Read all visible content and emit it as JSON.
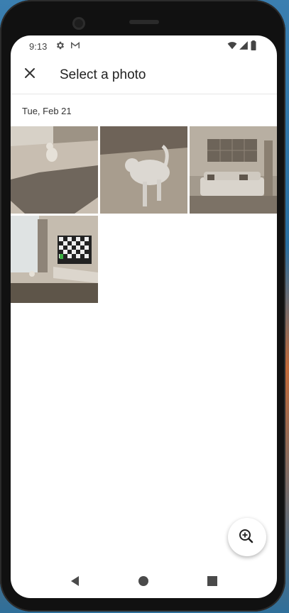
{
  "statusbar": {
    "time": "9:13",
    "icons": [
      "settings-icon",
      "gmail-icon",
      "wifi-icon",
      "signal-icon",
      "battery-icon"
    ]
  },
  "appbar": {
    "close_icon": "close-icon",
    "title": "Select a photo"
  },
  "gallery": {
    "date_header": "Tue, Feb 21",
    "photos": [
      {
        "subject": "cat in room with rug"
      },
      {
        "subject": "white cat in room"
      },
      {
        "subject": "living room with sofa"
      },
      {
        "subject": "room with checkerboard tv"
      }
    ]
  },
  "fab": {
    "icon": "zoom-in-icon"
  },
  "navbar": {
    "back_icon": "back-icon",
    "home_icon": "home-icon",
    "recents_icon": "recents-icon"
  },
  "colors": {
    "accent": "#1a1a1a",
    "photo_tone": "#8a7d6d"
  }
}
